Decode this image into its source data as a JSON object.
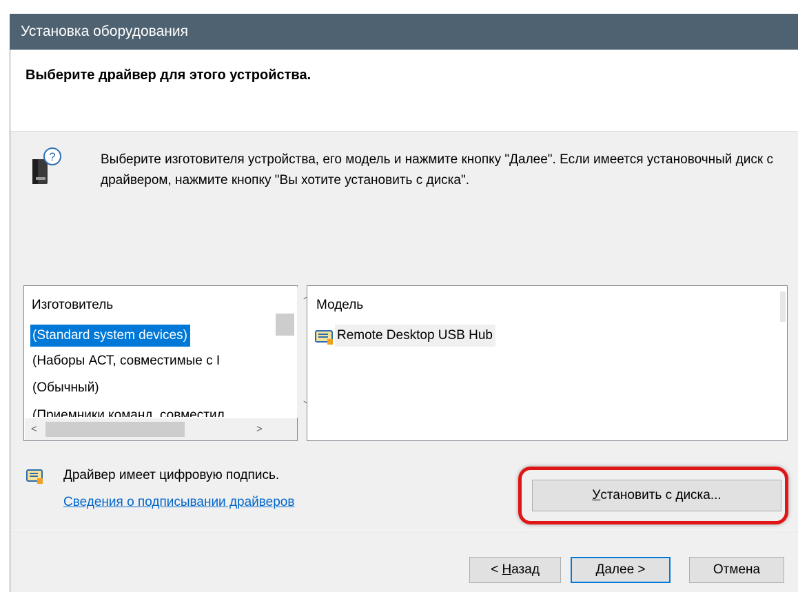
{
  "window": {
    "title": "Установка оборудования"
  },
  "header": {
    "title": "Выберите драйвер для этого устройства."
  },
  "instructions": "Выберите изготовителя устройства, его модель и нажмите кнопку \"Далее\". Если имеется установочный диск с драйвером, нажмите кнопку \"Вы хотите установить с диска\".",
  "manufacturer_list": {
    "header": "Изготовитель",
    "items": [
      "(Standard system devices)",
      "(Наборы АСТ, совместимые с I",
      "(Обычный)",
      "(Приемники команд, совместил"
    ],
    "selected_index": 0
  },
  "model_list": {
    "header": "Модель",
    "items": [
      "Remote Desktop USB Hub"
    ]
  },
  "signature": {
    "text": "Драйвер имеет цифровую подпись.",
    "link": "Сведения о подписывании драйверов"
  },
  "buttons": {
    "have_disk": {
      "pre": "",
      "acc": "У",
      "post": "становить с диска..."
    },
    "back": {
      "pre": "< ",
      "acc": "Н",
      "post": "азад"
    },
    "next": {
      "pre": "",
      "acc": "Д",
      "post": "алее >"
    },
    "cancel": "Отмена"
  },
  "colors": {
    "titlebar": "#4f6271",
    "selection": "#0078d7",
    "highlight_ring": "#e01616",
    "link": "#0066cc"
  }
}
